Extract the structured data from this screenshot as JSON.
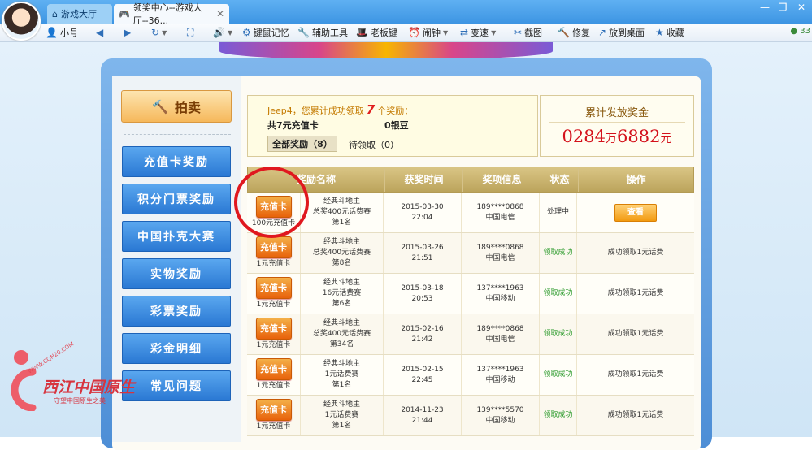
{
  "tabs": [
    {
      "label": "游戏大厅"
    },
    {
      "label": "领奖中心--游戏大厅--36..."
    }
  ],
  "window_controls": {
    "minimize": "—",
    "restore": "❐",
    "close": "✕"
  },
  "toolbar": {
    "user": "小号",
    "keyboard_memory": "键鼠记忆",
    "tools": "辅助工具",
    "boss_key": "老板键",
    "alarm": "闹钟",
    "speed": "变速",
    "screenshot": "截图",
    "repair": "修复",
    "desktop": "放到桌面",
    "favorite": "收藏",
    "percent": "33"
  },
  "sidebar": {
    "auction": "拍卖",
    "items": [
      {
        "label": "充值卡奖励"
      },
      {
        "label": "积分门票奖励"
      },
      {
        "label": "中国扑克大赛"
      },
      {
        "label": "实物奖励"
      },
      {
        "label": "彩票奖励"
      },
      {
        "label": "彩金明细"
      },
      {
        "label": "常见问题"
      }
    ]
  },
  "summary": {
    "line1_prefix": "Jeep4，您累计成功领取",
    "count": "7",
    "line1_suffix": "个奖励：",
    "card_total": "共7元充值卡",
    "silver": "0银豆",
    "filter_all": "全部奖励（8）",
    "filter_pending": "待领取（0）"
  },
  "total": {
    "label": "累计发放奖金",
    "value_wan": "0284",
    "unit_wan": "万",
    "value_rest": "6882",
    "unit_yuan": "元"
  },
  "table": {
    "headers": [
      "奖励名称",
      "获奖时间",
      "奖项信息",
      "状态",
      "操作"
    ],
    "card_label": "充值卡",
    "rows": [
      {
        "prize": "100元充值卡",
        "game": "经典斗地主",
        "match": "总奖400元话费赛",
        "rank": "第1名",
        "date": "2015-03-30",
        "time": "22:04",
        "phone": "189****0868",
        "carrier": "中国电信",
        "status": "处理中",
        "action": "查看",
        "action_type": "button"
      },
      {
        "prize": "1元充值卡",
        "game": "经典斗地主",
        "match": "总奖400元话费赛",
        "rank": "第8名",
        "date": "2015-03-26",
        "time": "21:51",
        "phone": "189****0868",
        "carrier": "中国电信",
        "status": "领取成功",
        "action": "成功领取1元话费",
        "action_type": "text"
      },
      {
        "prize": "1元充值卡",
        "game": "经典斗地主",
        "match": "16元话费赛",
        "rank": "第6名",
        "date": "2015-03-18",
        "time": "20:53",
        "phone": "137****1963",
        "carrier": "中国移动",
        "status": "领取成功",
        "action": "成功领取1元话费",
        "action_type": "text"
      },
      {
        "prize": "1元充值卡",
        "game": "经典斗地主",
        "match": "总奖400元话费赛",
        "rank": "第34名",
        "date": "2015-02-16",
        "time": "21:42",
        "phone": "189****0868",
        "carrier": "中国电信",
        "status": "领取成功",
        "action": "成功领取1元话费",
        "action_type": "text"
      },
      {
        "prize": "1元充值卡",
        "game": "经典斗地主",
        "match": "1元话费赛",
        "rank": "第1名",
        "date": "2015-02-15",
        "time": "22:45",
        "phone": "137****1963",
        "carrier": "中国移动",
        "status": "领取成功",
        "action": "成功领取1元话费",
        "action_type": "text"
      },
      {
        "prize": "1元充值卡",
        "game": "经典斗地主",
        "match": "1元话费赛",
        "rank": "第1名",
        "date": "2014-11-23",
        "time": "21:44",
        "phone": "139****5570",
        "carrier": "中国移动",
        "status": "领取成功",
        "action": "成功领取1元话费",
        "action_type": "text"
      }
    ]
  },
  "watermark": {
    "url": "WWW.CQN20.COM",
    "title": "西江中国原生",
    "slogan": "守望中国原生之美"
  },
  "colors": {
    "accent_blue": "#2a78d3",
    "red": "#d4111b",
    "gold": "#bca45c",
    "success": "#2a9a2a"
  }
}
